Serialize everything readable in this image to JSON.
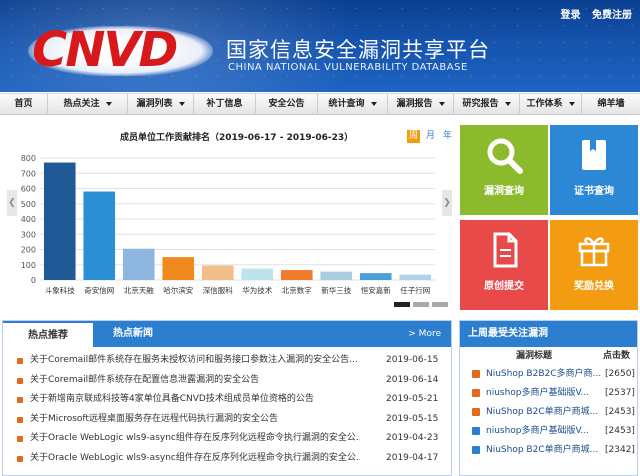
{
  "header": {
    "logo_text": "CNVD",
    "title_cn": "国家信息安全漏洞共享平台",
    "title_en": "CHINA NATIONAL VULNERABILITY DATABASE",
    "login": "登录",
    "register": "免费注册"
  },
  "nav": [
    {
      "label": "首页",
      "dropdown": false
    },
    {
      "label": "热点关注",
      "dropdown": true
    },
    {
      "label": "漏洞列表",
      "dropdown": true
    },
    {
      "label": "补丁信息",
      "dropdown": false
    },
    {
      "label": "安全公告",
      "dropdown": false
    },
    {
      "label": "统计查询",
      "dropdown": true
    },
    {
      "label": "漏洞报告",
      "dropdown": true
    },
    {
      "label": "研究报告",
      "dropdown": true
    },
    {
      "label": "工作体系",
      "dropdown": true
    },
    {
      "label": "绵羊墙",
      "dropdown": false
    }
  ],
  "chart_panel": {
    "title": "成员单位工作贡献排名（2019-06-17 - 2019-06-23）",
    "period_tabs": [
      "周",
      "月",
      "年"
    ],
    "active_tab": "周",
    "prev_icon": "chevron-left-icon",
    "next_icon": "chevron-right-icon"
  },
  "chart_data": {
    "type": "bar",
    "categories": [
      "斗象科技",
      "奇安信网",
      "北京天融",
      "哈尔滨安",
      "深信服科",
      "华为技术",
      "北京数字",
      "新华三技",
      "恒安嘉新",
      "任子行网"
    ],
    "values": [
      770,
      580,
      205,
      150,
      95,
      75,
      65,
      55,
      45,
      35
    ],
    "colors": [
      "#1f5a96",
      "#2c8fd6",
      "#8fb6df",
      "#f08a1c",
      "#f2be8a",
      "#bde3ec",
      "#f07b2c",
      "#a7cfe0",
      "#4a9fd8",
      "#aed1ea"
    ],
    "ylim": [
      0,
      800
    ],
    "yticks": [
      0,
      100,
      200,
      300,
      400,
      500,
      600,
      700,
      800
    ],
    "grid": true
  },
  "tiles": [
    {
      "label": "漏洞查询",
      "color": "#8bbb2c",
      "icon": "search-icon"
    },
    {
      "label": "证书查询",
      "color": "#2c88d4",
      "icon": "certificate-book-icon"
    },
    {
      "label": "原创提交",
      "color": "#e84a4a",
      "icon": "document-icon"
    },
    {
      "label": "奖励兑换",
      "color": "#f39c12",
      "icon": "gift-icon"
    }
  ],
  "hot_news": {
    "tab_active": "热点推荐",
    "tab_other": "热点新闻",
    "more": "> More",
    "items": [
      {
        "title": "关于Coremail邮件系统存在服务未授权访问和服务接口参数注入漏洞的安全公告...",
        "date": "2019-06-15"
      },
      {
        "title": "关于Coremail邮件系统存在配置信息泄露漏洞的安全公告",
        "date": "2019-06-14"
      },
      {
        "title": "关于新增南京联成科技等4家单位具备CNVD技术组成员单位资格的公告",
        "date": "2019-05-21"
      },
      {
        "title": "关于Microsoft远程桌面服务存在远程代码执行漏洞的安全公告",
        "date": "2019-05-15"
      },
      {
        "title": "关于Oracle WebLogic wls9-async组件存在反序列化远程命令执行漏洞的安全公...",
        "date": "2019-04-23"
      },
      {
        "title": "关于Oracle WebLogic wls9-async组件存在反序列化远程命令执行漏洞的安全公...",
        "date": "2019-04-17"
      }
    ]
  },
  "weekly": {
    "title": "上周最受关注漏洞",
    "col_title": "漏洞标题",
    "col_clicks": "点击数",
    "items": [
      {
        "title": "NiuShop B2B2C多商户商...",
        "clicks": "[2650]",
        "icon": "new"
      },
      {
        "title": "niushop多商户基础版V...",
        "clicks": "[2537]",
        "icon": "new"
      },
      {
        "title": "NiuShop B2C单商户商城...",
        "clicks": "[2453]",
        "icon": "new"
      },
      {
        "title": "niushop多商户基础版V...",
        "clicks": "[2453]",
        "icon": "old"
      },
      {
        "title": "NiuShop B2C单商户商城...",
        "clicks": "[2342]",
        "icon": "old"
      }
    ]
  }
}
